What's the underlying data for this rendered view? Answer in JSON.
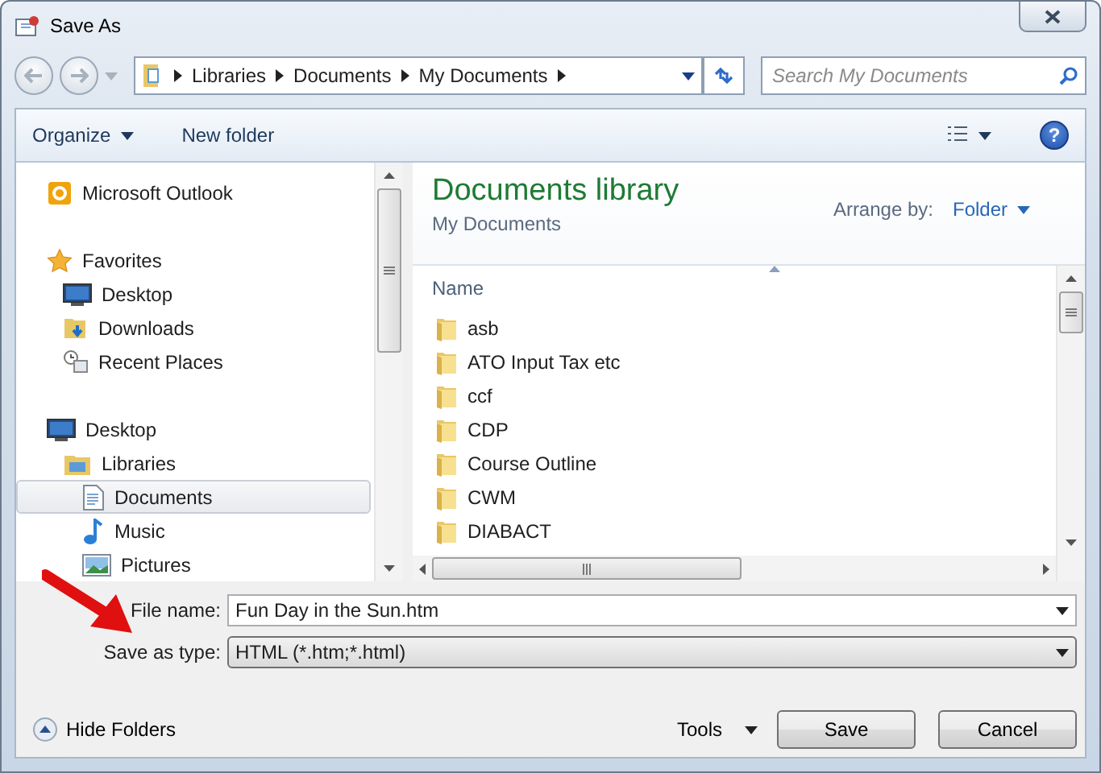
{
  "window": {
    "title": "Save As"
  },
  "address_bar": {
    "crumbs": [
      "Libraries",
      "Documents",
      "My Documents"
    ]
  },
  "search": {
    "placeholder": "Search My Documents"
  },
  "toolbar": {
    "buttons": [
      {
        "label": "Organize",
        "dropdown": true
      },
      {
        "label": "New folder",
        "dropdown": false
      }
    ]
  },
  "navigation": [
    {
      "label": "Microsoft Outlook",
      "kind": "outlook",
      "selected": false
    },
    {
      "label": "Favorites",
      "kind": "favorites",
      "selected": false,
      "children": [
        {
          "label": "Desktop",
          "kind": "desktop",
          "selected": false
        },
        {
          "label": "Downloads",
          "kind": "downloads",
          "selected": false
        },
        {
          "label": "Recent Places",
          "kind": "recent",
          "selected": false
        }
      ]
    },
    {
      "label": "Desktop",
      "kind": "desktop",
      "selected": false,
      "children": [
        {
          "label": "Libraries",
          "kind": "libraries",
          "selected": false,
          "children": [
            {
              "label": "Documents",
              "kind": "documents",
              "selected": true
            },
            {
              "label": "Music",
              "kind": "music",
              "selected": false
            },
            {
              "label": "Pictures",
              "kind": "pictures",
              "selected": false
            }
          ]
        }
      ]
    }
  ],
  "library": {
    "title": "Documents library",
    "subtitle": "My Documents",
    "arrange_label": "Arrange by:",
    "arrange_value": "Folder"
  },
  "file_list": {
    "column": "Name",
    "items": [
      "asb",
      "ATO Input Tax etc",
      "ccf",
      "CDP",
      "Course Outline",
      "CWM",
      "DIABACT"
    ]
  },
  "form": {
    "fields": [
      {
        "label": "File name:",
        "value": "Fun Day in the Sun.htm",
        "kind": "combo"
      },
      {
        "label": "Save as type:",
        "value": "HTML (*.htm;*.html)",
        "kind": "select"
      }
    ]
  },
  "hide_folders": "Hide Folders",
  "tools": "Tools",
  "help": "?",
  "buttons": [
    "Save",
    "Cancel"
  ]
}
